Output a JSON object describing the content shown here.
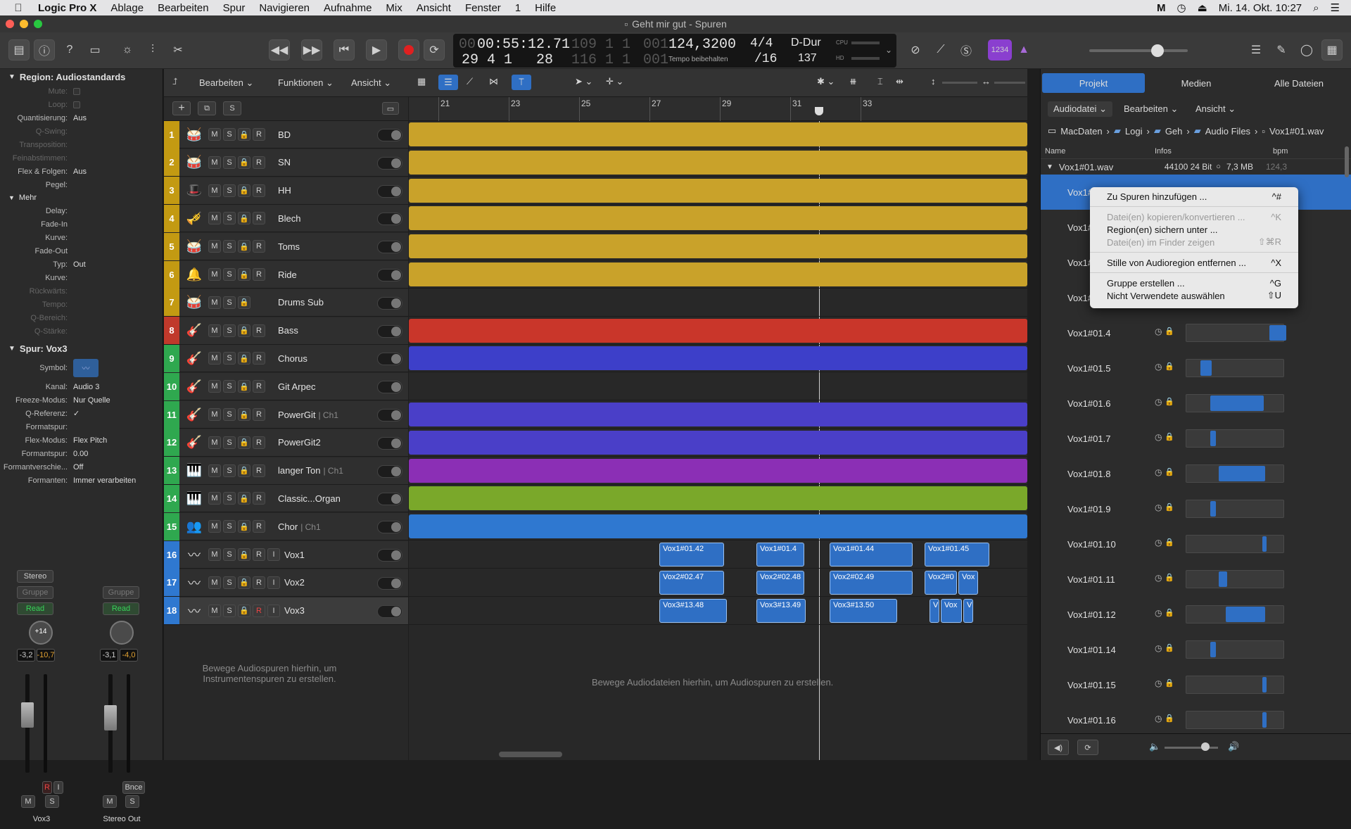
{
  "menubar": {
    "app": "Logic Pro X",
    "items": [
      "Ablage",
      "Bearbeiten",
      "Spur",
      "Navigieren",
      "Aufnahme",
      "Mix",
      "Ansicht",
      "Fenster",
      "1",
      "Hilfe"
    ],
    "clock": "Mi. 14. Okt.  10:27"
  },
  "window": {
    "title": "Geht mir gut - Spuren"
  },
  "lcd": {
    "time": "00:55:12.71",
    "time_hi": "00",
    "bars": "109  1  1",
    "bars_sub": "001",
    "bars2": "29  4  1",
    "bars2_sub": "28",
    "bars3": "116  1  1",
    "bars3_sub": "001",
    "tempo": "124,3200",
    "tempo_label": "Tempo beibehalten",
    "sig": "4/4",
    "div": "/16",
    "key": "D-Dur",
    "keyval": "137",
    "cpu": "CPU",
    "hd": "HD",
    "counter": "1234"
  },
  "inspector": {
    "region_header": "Region: Audiostandards",
    "params": [
      {
        "label": "Mute:",
        "value": "",
        "chk": true,
        "dim": true
      },
      {
        "label": "Loop:",
        "value": "",
        "chk": true,
        "dim": true
      },
      {
        "label": "Quantisierung:",
        "value": "Aus"
      },
      {
        "label": "Q-Swing:",
        "value": "",
        "dim": true
      },
      {
        "label": "Transposition:",
        "value": "",
        "dim": true
      },
      {
        "label": "Feinabstimmen:",
        "value": "",
        "dim": true
      },
      {
        "label": "Flex & Folgen:",
        "value": "Aus"
      },
      {
        "label": "Pegel:",
        "value": ""
      }
    ],
    "mehr": "Mehr",
    "mehr_params": [
      {
        "label": "Delay:",
        "value": ""
      },
      {
        "label": "Fade-In",
        "value": ""
      },
      {
        "label": "Kurve:",
        "value": ""
      },
      {
        "label": "Fade-Out",
        "value": ""
      },
      {
        "label": "Typ:",
        "value": "Out"
      },
      {
        "label": "Kurve:",
        "value": ""
      },
      {
        "label": "Rückwärts:",
        "value": "",
        "dim": true
      },
      {
        "label": "Tempo:",
        "value": "",
        "dim": true
      },
      {
        "label": "Q-Bereich:",
        "value": "",
        "dim": true
      },
      {
        "label": "Q-Stärke:",
        "value": "",
        "dim": true
      }
    ],
    "track_header": "Spur:  Vox3",
    "symbol_label": "Symbol:",
    "track_params": [
      {
        "label": "Kanal:",
        "value": "Audio 3"
      },
      {
        "label": "Freeze-Modus:",
        "value": "Nur Quelle"
      },
      {
        "label": "Q-Referenz:",
        "value": "✓"
      },
      {
        "label": "Formatspur:",
        "value": ""
      },
      {
        "label": "Flex-Modus:",
        "value": "Flex Pitch"
      },
      {
        "label": "Formantspur:",
        "value": "0.00"
      },
      {
        "label": "Formantverschie...",
        "value": "Off"
      },
      {
        "label": "Formanten:",
        "value": "Immer verarbeiten"
      }
    ],
    "strip1": {
      "format": "Stereo",
      "group": "Gruppe",
      "auto": "Read",
      "knob": "+14",
      "l": "-3,2",
      "r": "-10,7",
      "name": "Vox3",
      "m": "M",
      "s": "S",
      "ri": "R",
      "ii": "I"
    },
    "strip2": {
      "group": "Gruppe",
      "auto": "Read",
      "l": "-3,1",
      "r": "-4,0",
      "name": "Stereo Out",
      "m": "M",
      "s": "S",
      "bnce": "Bnce"
    }
  },
  "tracks_header": {
    "bearbeiten": "Bearbeiten",
    "funktionen": "Funktionen",
    "ansicht": "Ansicht",
    "s_btn": "S"
  },
  "ruler": [
    "21",
    "23",
    "25",
    "27",
    "29",
    "31",
    "33"
  ],
  "tracks": [
    {
      "n": "1",
      "name": "BD",
      "sub": "",
      "numColor": "#c39a12",
      "laneColor": "#c9a22a",
      "icon": "🥁"
    },
    {
      "n": "2",
      "name": "SN",
      "sub": "",
      "numColor": "#c39a12",
      "laneColor": "#c9a22a",
      "icon": "🥁"
    },
    {
      "n": "3",
      "name": "HH",
      "sub": "",
      "numColor": "#c39a12",
      "laneColor": "#c9a22a",
      "icon": "🎩"
    },
    {
      "n": "4",
      "name": "Blech",
      "sub": "",
      "numColor": "#c39a12",
      "laneColor": "#c9a22a",
      "icon": "🎺"
    },
    {
      "n": "5",
      "name": "Toms",
      "sub": "",
      "numColor": "#c39a12",
      "laneColor": "#c9a22a",
      "icon": "🥁"
    },
    {
      "n": "6",
      "name": "Ride",
      "sub": "",
      "numColor": "#c39a12",
      "laneColor": "#c9a22a",
      "icon": "🔔"
    },
    {
      "n": "7",
      "name": "Drums Sub",
      "sub": "",
      "numColor": "#c39a12",
      "laneColor": "",
      "icon": "🥁"
    },
    {
      "n": "8",
      "name": "Bass",
      "sub": "",
      "numColor": "#c0392b",
      "laneColor": "#c9362a",
      "icon": "🎸"
    },
    {
      "n": "9",
      "name": "Chorus",
      "sub": "",
      "numColor": "#2fa84f",
      "laneColor": "#3d3fc9",
      "icon": "🎸"
    },
    {
      "n": "10",
      "name": "Git Arpec",
      "sub": "",
      "numColor": "#2fa84f",
      "laneColor": "",
      "icon": "🎸"
    },
    {
      "n": "11",
      "name": "PowerGit",
      "sub": "| Ch1",
      "numColor": "#2fa84f",
      "laneColor": "#4a3fc8",
      "icon": "🎸"
    },
    {
      "n": "12",
      "name": "PowerGit2",
      "sub": "",
      "numColor": "#2fa84f",
      "laneColor": "#4a3fc8",
      "icon": "🎸"
    },
    {
      "n": "13",
      "name": "langer Ton",
      "sub": "| Ch1",
      "numColor": "#2fa84f",
      "laneColor": "#8b2fb5",
      "icon": "🎹"
    },
    {
      "n": "14",
      "name": "Classic...Organ",
      "sub": "",
      "numColor": "#2fa84f",
      "laneColor": "#7aa82a",
      "icon": "🎹"
    },
    {
      "n": "15",
      "name": "Chor",
      "sub": "| Ch1",
      "numColor": "#2fa84f",
      "laneColor": "#2f78d0",
      "icon": "👥"
    },
    {
      "n": "16",
      "name": "Vox1",
      "sub": "",
      "numColor": "#2f78d0",
      "laneColor": "",
      "icon": "〰"
    },
    {
      "n": "17",
      "name": "Vox2",
      "sub": "",
      "numColor": "#2f78d0",
      "laneColor": "",
      "icon": "〰"
    },
    {
      "n": "18",
      "name": "Vox3",
      "sub": "",
      "numColor": "#2f78d0",
      "laneColor": "",
      "icon": "〰"
    }
  ],
  "vox_regions": {
    "vox1": [
      "Vox1#01.42",
      "Vox1#01.4",
      "Vox1#01.44",
      "Vox1#01.45"
    ],
    "vox2": [
      "Vox2#02.47",
      "Vox2#02.48",
      "Vox2#02.49",
      "Vox2#0",
      "Vox"
    ],
    "vox3": [
      "Vox3#13.48",
      "Vox3#13.49",
      "Vox3#13.50",
      "V",
      "Vox",
      "V"
    ]
  },
  "hint_tracks": "Bewege Audiospuren hierhin, um Instrumentenspuren zu erstellen.",
  "hint_arrange": "Bewege Audiodateien hierhin, um Audiospuren zu erstellen.",
  "browser": {
    "tabs": [
      "Projekt",
      "Medien",
      "Alle Dateien"
    ],
    "menus": [
      "Audiodatei",
      "Bearbeiten",
      "Ansicht"
    ],
    "path": [
      "MacDaten",
      "Logi",
      "Geh",
      "Audio Files",
      "Vox1#01.wav"
    ],
    "cols": [
      "Name",
      "Infos",
      "bpm"
    ],
    "file": {
      "name": "Vox1#01.wav",
      "info": "44100  24 Bit",
      "size": "7,3 MB",
      "bpm": "124,3"
    },
    "items": [
      "Vox1#",
      "Vox1#",
      "Vox1#",
      "Vox1#",
      "Vox1#01.4",
      "Vox1#01.5",
      "Vox1#01.6",
      "Vox1#01.7",
      "Vox1#01.8",
      "Vox1#01.9",
      "Vox1#01.10",
      "Vox1#01.11",
      "Vox1#01.12",
      "Vox1#01.14",
      "Vox1#01.15",
      "Vox1#01.16"
    ]
  },
  "context_menu": [
    {
      "label": "Zu Spuren hinzufügen ...",
      "key": "^#",
      "dis": false
    },
    {
      "sep": true
    },
    {
      "label": "Datei(en) kopieren/konvertieren ...",
      "key": "^K",
      "dis": true
    },
    {
      "label": "Region(en) sichern unter ...",
      "key": "",
      "dis": false
    },
    {
      "label": "Datei(en) im Finder zeigen",
      "key": "⇧⌘R",
      "dis": true
    },
    {
      "sep": true
    },
    {
      "label": "Stille von Audioregion entfernen ...",
      "key": "^X",
      "dis": false
    },
    {
      "sep": true
    },
    {
      "label": "Gruppe erstellen ...",
      "key": "^G",
      "dis": false
    },
    {
      "label": "Nicht Verwendete auswählen",
      "key": "⇧U",
      "dis": false
    }
  ]
}
